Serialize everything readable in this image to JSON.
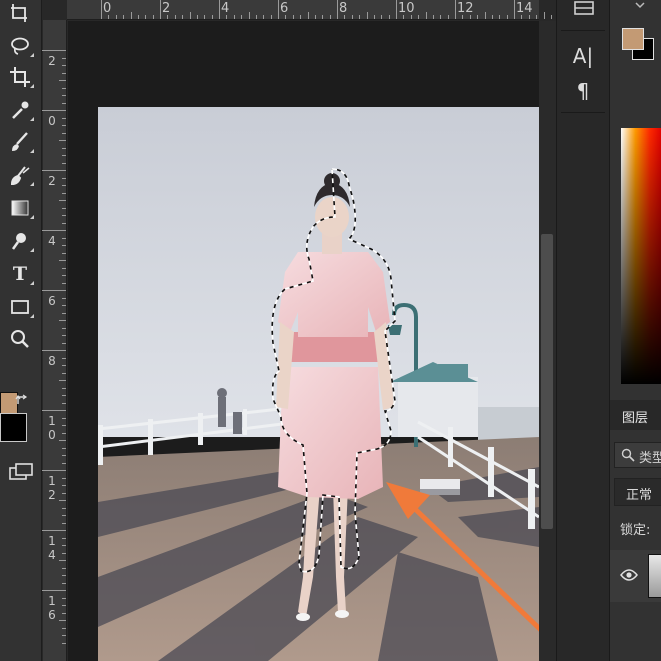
{
  "app": {
    "colors": {
      "foreground": "#c39a74",
      "background": "#000000",
      "selection_arrow": "#f07a3a",
      "panel": "#323232",
      "canvas": "#1c1c1c"
    }
  },
  "tools": [
    {
      "name": "marquee",
      "icon": "rect-marquee-icon"
    },
    {
      "name": "lasso",
      "icon": "lasso-icon"
    },
    {
      "name": "crop",
      "icon": "crop-icon"
    },
    {
      "name": "eyedropper",
      "icon": "eyedropper-icon"
    },
    {
      "name": "brush",
      "icon": "brush-icon"
    },
    {
      "name": "stamp",
      "icon": "stamp-icon"
    },
    {
      "name": "gradient",
      "icon": "gradient-icon"
    },
    {
      "name": "dodge",
      "icon": "dodge-icon"
    },
    {
      "name": "type",
      "icon": "type-icon",
      "label": "T"
    },
    {
      "name": "shape",
      "icon": "rectangle-icon"
    },
    {
      "name": "zoom",
      "icon": "zoom-icon"
    }
  ],
  "rulers": {
    "horizontal": [
      "0",
      "2",
      "4",
      "6",
      "8",
      "10",
      "12",
      "14"
    ],
    "vertical": [
      [
        "2"
      ],
      [
        "0"
      ],
      [
        "2"
      ],
      [
        "4"
      ],
      [
        "6"
      ],
      [
        "8"
      ],
      [
        "1",
        "0"
      ],
      [
        "1",
        "2"
      ],
      [
        "1",
        "4"
      ],
      [
        "1",
        "6"
      ]
    ]
  },
  "mid_panel": {
    "character_label": "A|",
    "paragraph_label": "¶"
  },
  "layers_panel": {
    "tab_label": "图层",
    "search_label": "类型",
    "blend_mode": "正常",
    "lock_label": "锁定:"
  },
  "photo": {
    "subject": "woman in pink dress on pier",
    "selection": "marching-ants",
    "arrow_color": "#f07a3a"
  }
}
